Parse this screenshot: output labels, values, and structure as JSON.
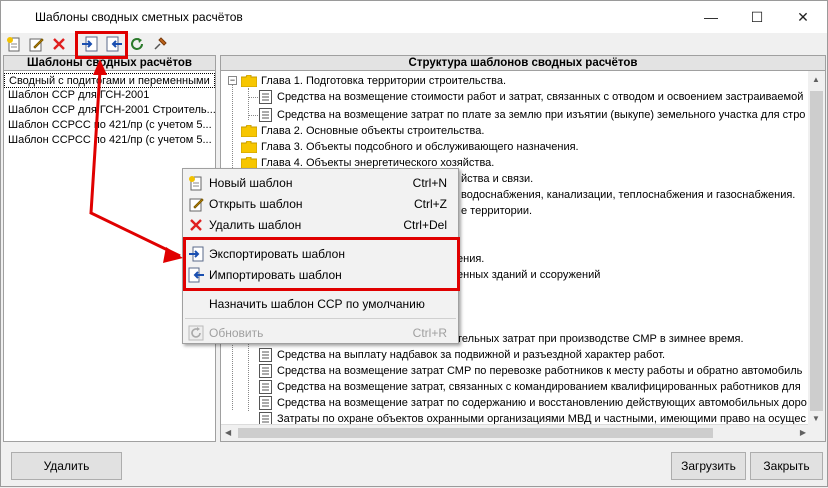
{
  "window": {
    "title": "Шаблоны сводных сметных расчётов",
    "minimize": "—",
    "maximize": "☐",
    "close": "✕"
  },
  "toolbar": {
    "icons": [
      "new-template-icon",
      "open-template-icon",
      "delete-icon",
      "export-icon",
      "import-icon",
      "refresh-icon",
      "pin-icon"
    ]
  },
  "left_panel": {
    "header": "Шаблоны сводных расчётов",
    "items": [
      "Сводный с подитогами и переменными",
      "Шаблон ССР для ГСН-2001",
      "Шаблон ССР для ГСН-2001 Строитель...",
      "Шаблон ССРСС по 421/пр (с учетом 5...",
      "Шаблон ССРСС по 421/пр (с учетом 5..."
    ]
  },
  "right_panel": {
    "header": "Структура шаблонов сводных расчётов",
    "rows": [
      "Глава  1. Подготовка территории строительства.",
      "Средства на возмещение стоимости работ и затрат, связанных с отводом и освоением застраиваемой",
      "Средства на возмещение затрат по плате за землю при изъятии (выкупе) земельного участка для стро",
      "Глава  2. Основные объекты строительства.",
      "Глава  3. Объекты подсобного и обслуживающего назначения.",
      "Глава  4. Объекты энергетического хозяйства.",
      "йства и связи.",
      "водоснабжения, канализации, теплоснабжения и газоснабжения.",
      "е территории.",
      "ения.",
      "енных зданий и ссоружений",
      "тельных затрат при производстве СМР в зимнее время.",
      "Средства на выплату надбавок за подвижной и разъездной характер работ.",
      "Средства на возмещение затрат СМР по перевозке работников к месту работы и обратно автомобиль",
      "Средства на возмещение затрат, связанных с командированием квалифицированных работников для",
      "Средства на возмещение затрат по содержанию и восстановлению действующих автомобильных доро",
      "Затраты по охране объектов охранными организациями МВД и частными, имеющими право на осущес"
    ]
  },
  "context_menu": {
    "items": [
      {
        "label": "Новый шаблон",
        "shortcut": "Ctrl+N",
        "icon": "new-template-icon"
      },
      {
        "label": "Открыть шаблон",
        "shortcut": "Ctrl+Z",
        "icon": "open-template-icon"
      },
      {
        "label": "Удалить шаблон",
        "shortcut": "Ctrl+Del",
        "icon": "delete-icon"
      },
      {
        "label": "Экспортировать шаблон",
        "shortcut": "",
        "icon": "export-icon"
      },
      {
        "label": "Импортировать шаблон",
        "shortcut": "",
        "icon": "import-icon"
      },
      {
        "label": "Назначить шаблон ССР по умолчанию",
        "shortcut": "",
        "icon": ""
      },
      {
        "label": "Обновить",
        "shortcut": "Ctrl+R",
        "icon": "refresh-icon"
      }
    ]
  },
  "buttons": {
    "delete": "Удалить",
    "load": "Загрузить",
    "close": "Закрыть"
  },
  "colors": {
    "highlight": "#e00000",
    "folder": "#f7c600"
  }
}
